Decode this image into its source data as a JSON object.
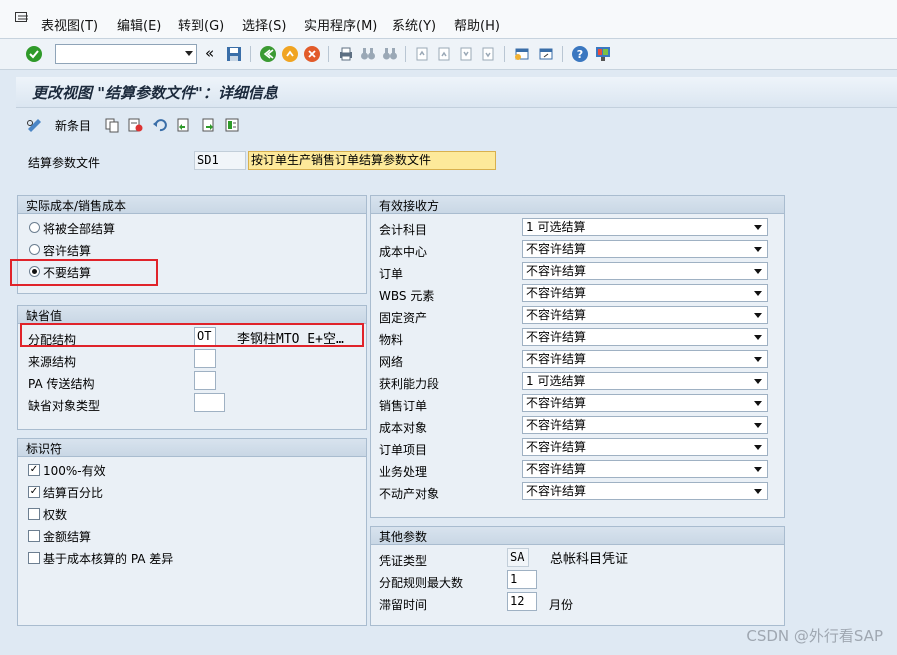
{
  "menu": {
    "items": [
      "表视图(T)",
      "编辑(E)",
      "转到(G)",
      "选择(S)",
      "实用程序(M)",
      "系统(Y)",
      "帮助(H)"
    ]
  },
  "toolbar": {
    "command_field": "",
    "nav_back_symbol": "«"
  },
  "header": {
    "title": "更改视图 \"结算参数文件\"：详细信息"
  },
  "app_toolbar": {
    "new_entries_label": "新条目"
  },
  "profile": {
    "label": "结算参数文件",
    "code": "SD1",
    "description": "按订单生产销售订单结算参数文件"
  },
  "actual_costs": {
    "title": "实际成本/销售成本",
    "options": [
      {
        "label": "将被全部结算",
        "selected": false
      },
      {
        "label": "容许结算",
        "selected": false
      },
      {
        "label": "不要结算",
        "selected": true
      }
    ]
  },
  "defaults": {
    "title": "缺省值",
    "alloc_structure": {
      "label": "分配结构",
      "value": "OT",
      "text": "李钢柱MTO E+空…"
    },
    "source_structure": {
      "label": "来源结构",
      "value": ""
    },
    "pa_transfer": {
      "label": "PA 传送结构",
      "value": ""
    },
    "default_object_type": {
      "label": "缺省对象类型",
      "value": ""
    }
  },
  "indicators": {
    "title": "标识符",
    "items": [
      {
        "label": "100%-有效",
        "checked": true
      },
      {
        "label": "结算百分比",
        "checked": true
      },
      {
        "label": "权数",
        "checked": false
      },
      {
        "label": "金额结算",
        "checked": false
      },
      {
        "label": "基于成本核算的 PA 差异",
        "checked": false
      }
    ]
  },
  "receivers": {
    "title": "有效接收方",
    "rows": [
      {
        "label": "会计科目",
        "value": "1 可选结算"
      },
      {
        "label": "成本中心",
        "value": "不容许结算"
      },
      {
        "label": "订单",
        "value": "不容许结算"
      },
      {
        "label": "WBS 元素",
        "value": "不容许结算"
      },
      {
        "label": "固定资产",
        "value": "不容许结算"
      },
      {
        "label": "物料",
        "value": "不容许结算"
      },
      {
        "label": "网络",
        "value": "不容许结算"
      },
      {
        "label": "获利能力段",
        "value": "1 可选结算"
      },
      {
        "label": "销售订单",
        "value": "不容许结算"
      },
      {
        "label": "成本对象",
        "value": "不容许结算"
      },
      {
        "label": "订单项目",
        "value": "不容许结算"
      },
      {
        "label": "业务处理",
        "value": "不容许结算"
      },
      {
        "label": "不动产对象",
        "value": "不容许结算"
      }
    ]
  },
  "other_params": {
    "title": "其他参数",
    "doc_type": {
      "label": "凭证类型",
      "value": "SA",
      "text": "总帐科目凭证"
    },
    "max_dist_rules": {
      "label": "分配规则最大数",
      "value": "1"
    },
    "residence_time": {
      "label": "滞留时间",
      "value": "12",
      "unit": "月份"
    }
  },
  "watermark": "CSDN @外行看SAP",
  "colors": {
    "highlight_red": "#e0232a",
    "desc_field_yellow": "#fde99a",
    "background": "#dfe9f3"
  }
}
